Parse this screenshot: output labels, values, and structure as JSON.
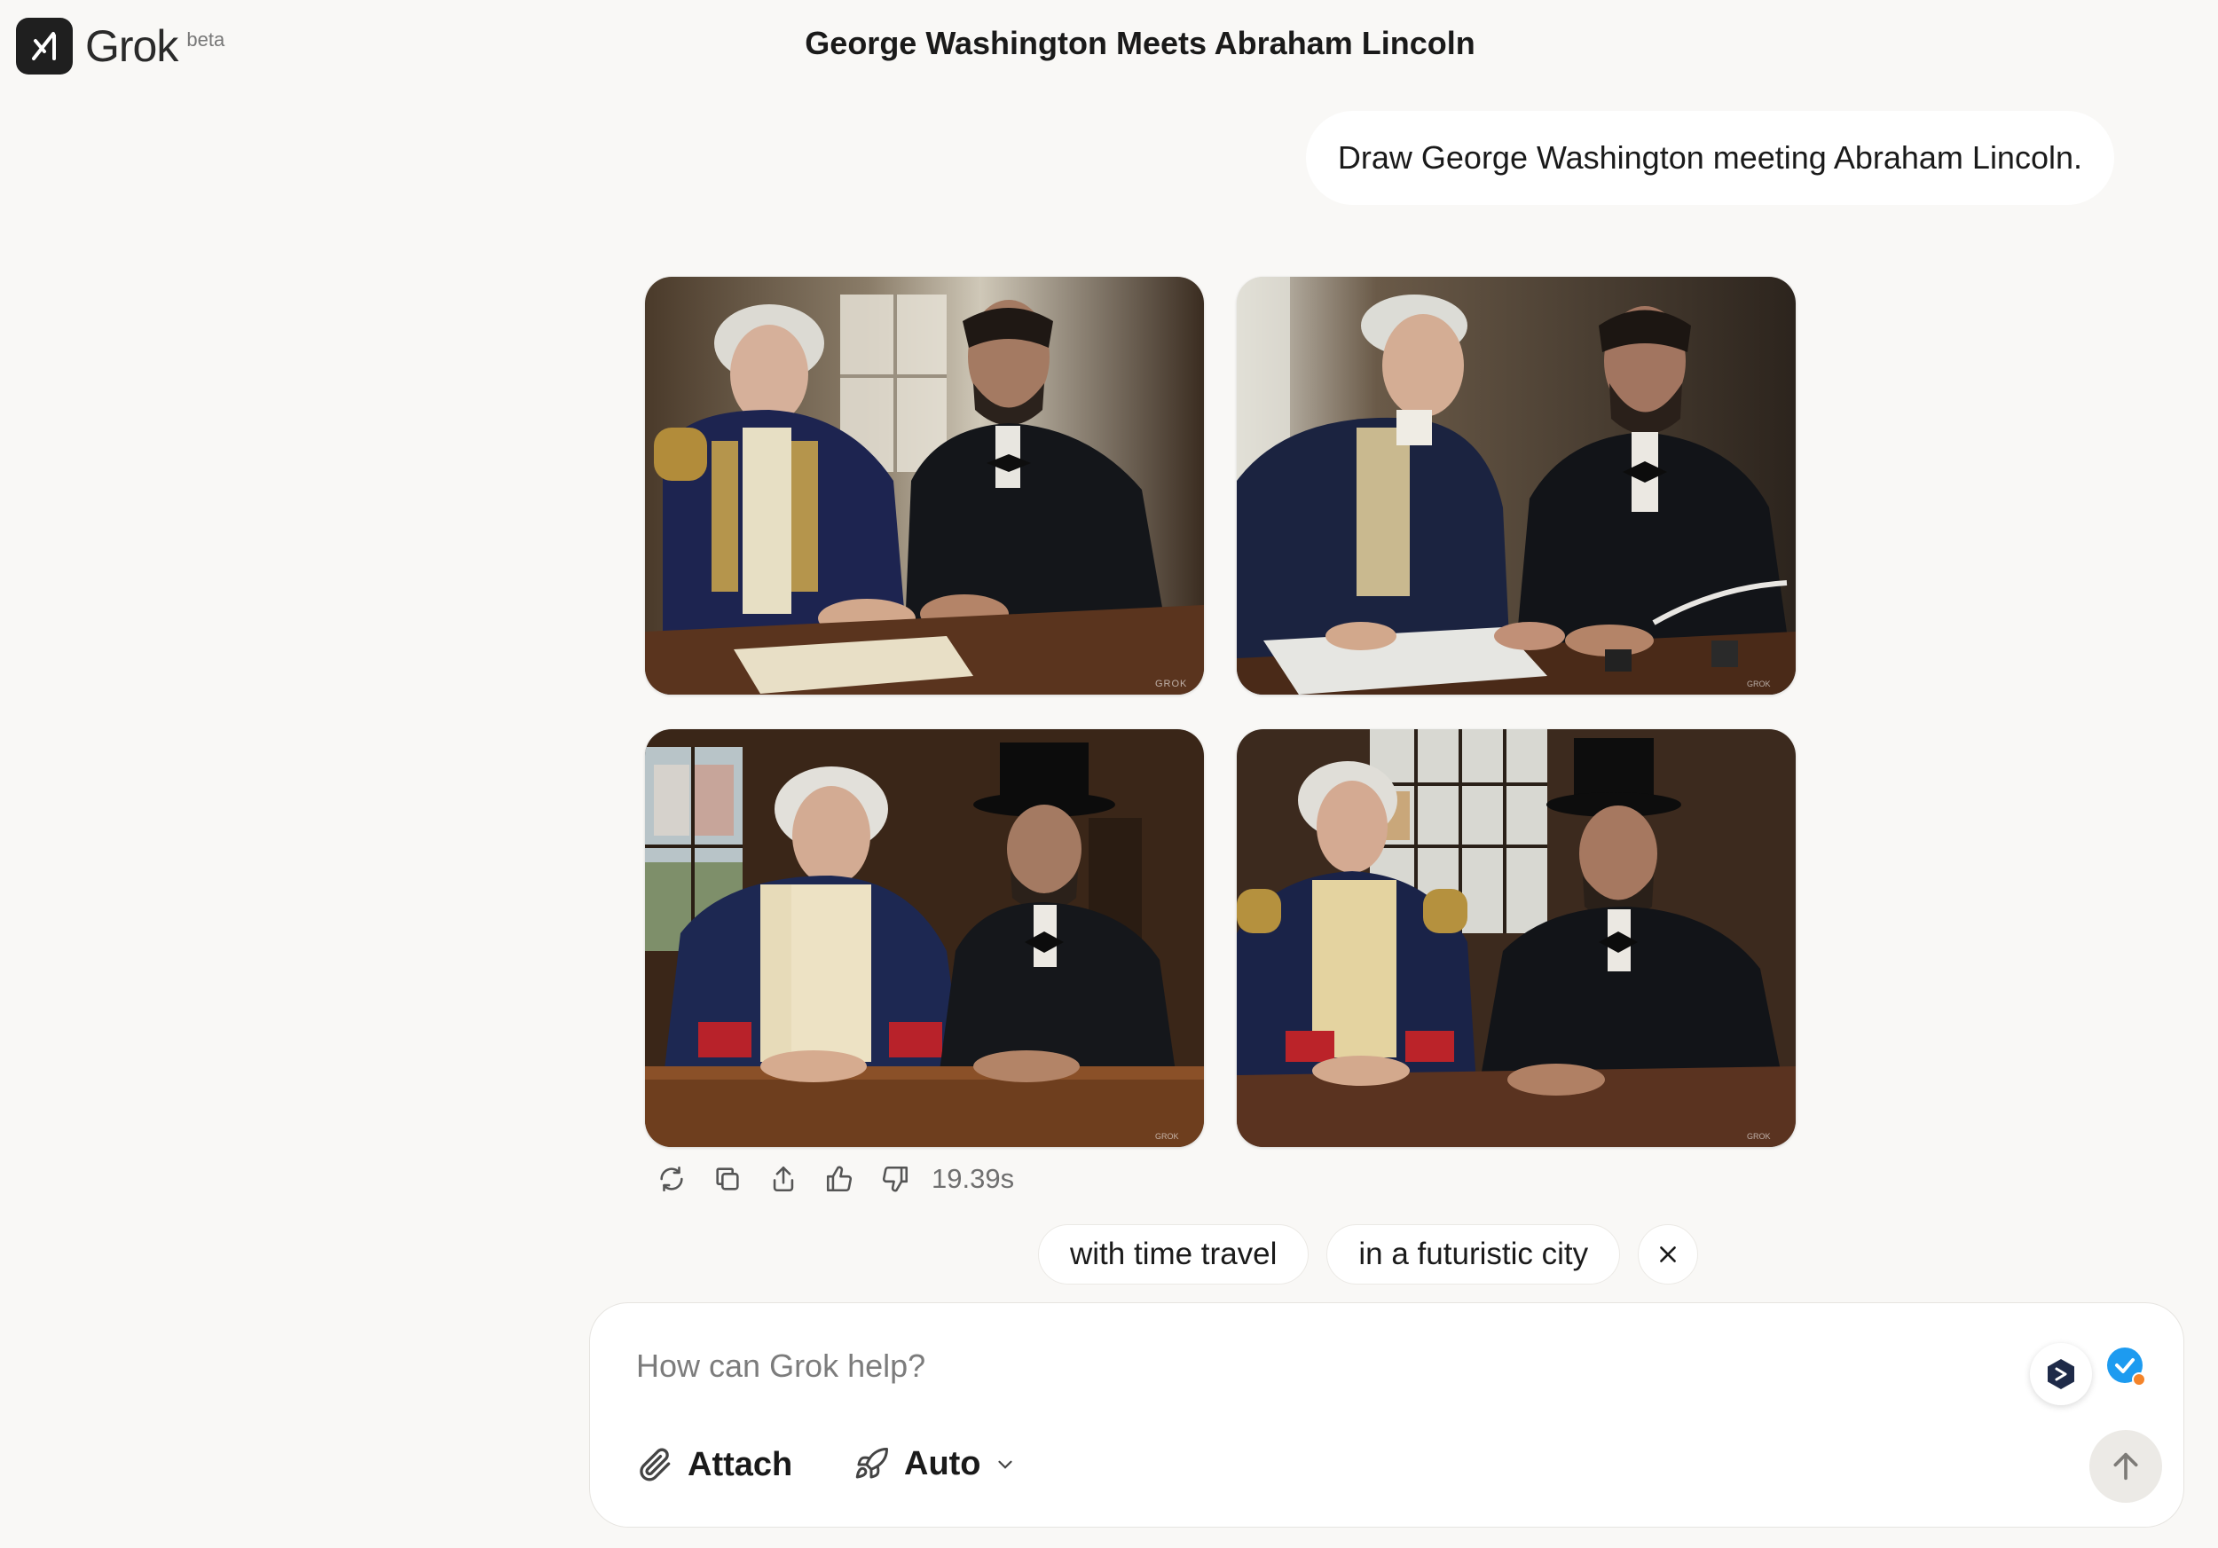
{
  "header": {
    "logo_text": "Grok",
    "beta_label": "beta",
    "conversation_title": "George Washington Meets Abraham Lincoln"
  },
  "chat": {
    "user_message": "Draw George Washington meeting Abraham Lincoln.",
    "images": [
      {
        "icon": "generated-image-1",
        "watermark": "GROK"
      },
      {
        "icon": "generated-image-2",
        "watermark": "GROK"
      },
      {
        "icon": "generated-image-3",
        "watermark": "GROK"
      },
      {
        "icon": "generated-image-4",
        "watermark": "GROK"
      }
    ],
    "actions": {
      "icons": [
        "regenerate-icon",
        "copy-icon",
        "share-icon",
        "thumbs-up-icon",
        "thumbs-down-icon"
      ],
      "response_time": "19.39s"
    },
    "suggestions": [
      "with time travel",
      "in a futuristic city"
    ]
  },
  "composer": {
    "placeholder": "How can Grok help?",
    "attach_label": "Attach",
    "mode_label": "Auto"
  },
  "colors": {
    "background": "#f9f8f6",
    "accent_blue": "#1d9bf0",
    "notification_orange": "#f4842a"
  }
}
